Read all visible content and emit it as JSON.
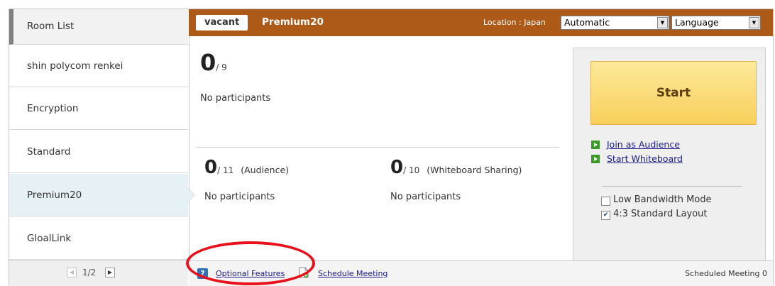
{
  "sidebar": {
    "header": "Room List",
    "items": [
      {
        "label": "shin polycom renkei"
      },
      {
        "label": "Encryption"
      },
      {
        "label": "Standard"
      },
      {
        "label": "Premium20"
      },
      {
        "label": "GloalLink"
      }
    ],
    "selected_index": 3,
    "pager": {
      "text": "1/2",
      "prev_icon": "◀",
      "next_icon": "▶"
    }
  },
  "header": {
    "status_badge": "vacant",
    "room_name": "Premium20",
    "location_label": "Location : Japan",
    "location_select": "Automatic",
    "language_select": "Language",
    "accent_color": "#ad5a19"
  },
  "participants": {
    "main": {
      "count": "0",
      "max": "/ 9",
      "status": "No participants"
    },
    "audience": {
      "count": "0",
      "max": "/ 11",
      "label": "(Audience)",
      "status": "No participants"
    },
    "whiteboard": {
      "count": "0",
      "max": "/ 10",
      "label": "(Whiteboard Sharing)",
      "status": "No participants"
    }
  },
  "panel": {
    "start_label": "Start",
    "links": [
      "Join as Audience",
      "Start Whiteboard"
    ],
    "options": [
      {
        "label": "Low Bandwidth Mode",
        "checked": false
      },
      {
        "label": "4:3 Standard Layout",
        "checked": true
      }
    ]
  },
  "footer": {
    "help_icon": "?",
    "optional_features": "Optional Features",
    "schedule_meeting": "Schedule Meeting",
    "scheduled_count": "Scheduled Meeting 0"
  }
}
